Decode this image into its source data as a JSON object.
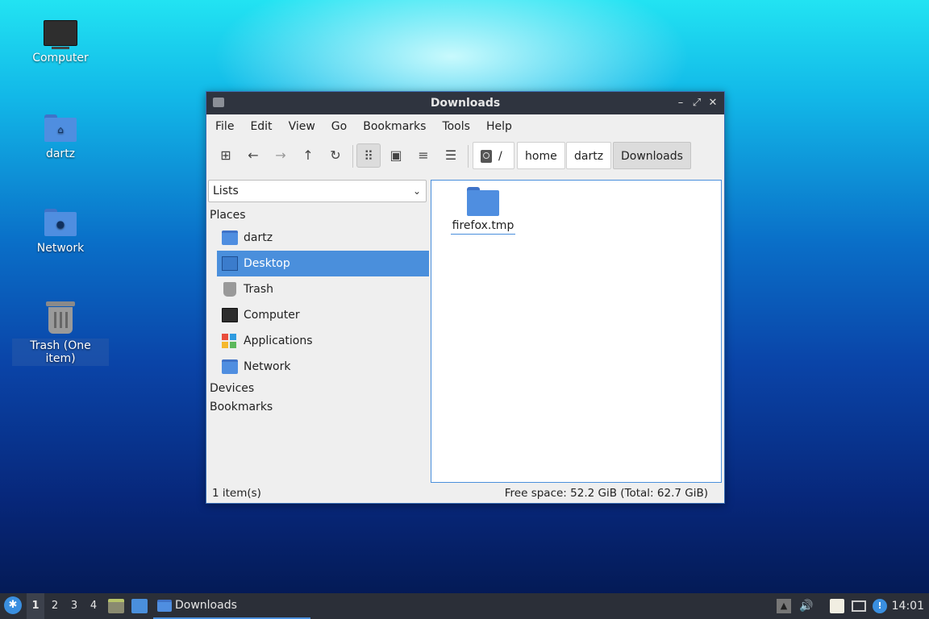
{
  "desktop": {
    "icons": [
      {
        "label": "Computer"
      },
      {
        "label": "dartz"
      },
      {
        "label": "Network"
      },
      {
        "label": "Trash (One item)"
      }
    ]
  },
  "window": {
    "title": "Downloads",
    "controls": {
      "minimize": "–",
      "maximize": "⤢",
      "close": "✕"
    },
    "menu": [
      "File",
      "Edit",
      "View",
      "Go",
      "Bookmarks",
      "Tools",
      "Help"
    ],
    "breadcrumb": [
      "/",
      "home",
      "dartz",
      "Downloads"
    ],
    "side_pane_mode": "Lists",
    "sections": {
      "places": "Places",
      "devices": "Devices",
      "bookmarks": "Bookmarks"
    },
    "places": [
      {
        "label": "dartz",
        "icon": "home-folder-icon"
      },
      {
        "label": "Desktop",
        "icon": "desktop-icon",
        "selected": true
      },
      {
        "label": "Trash",
        "icon": "trash-icon"
      },
      {
        "label": "Computer",
        "icon": "computer-icon"
      },
      {
        "label": "Applications",
        "icon": "applications-icon"
      },
      {
        "label": "Network",
        "icon": "network-folder-icon"
      }
    ],
    "files": [
      {
        "name": "firefox.tmp",
        "icon": "folder-icon"
      }
    ],
    "status": {
      "items": "1 item(s)",
      "free_space": "Free space: 52.2 GiB (Total: 62.7 GiB)"
    }
  },
  "taskbar": {
    "workspaces": [
      "1",
      "2",
      "3",
      "4"
    ],
    "task_title": "Downloads",
    "clock": "14:01"
  },
  "colors": {
    "accent": "#4a8fdc",
    "titlebar": "#2f343f",
    "taskbar": "#2b2f38"
  }
}
